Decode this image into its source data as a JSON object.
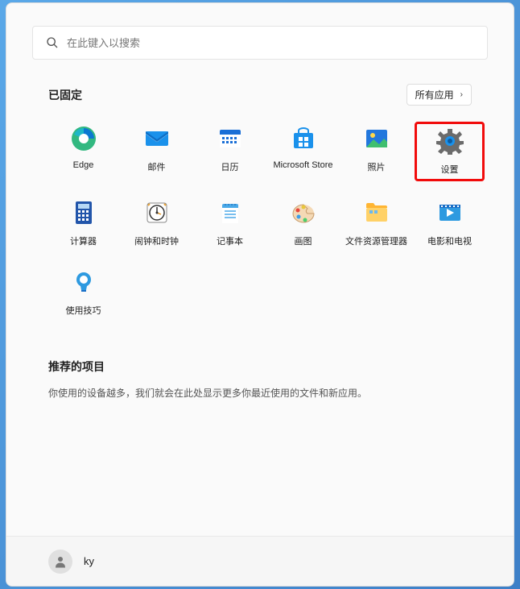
{
  "search": {
    "placeholder": "在此键入以搜索"
  },
  "pinned": {
    "title": "已固定",
    "all_apps_label": "所有应用",
    "tiles": [
      {
        "label": "Edge",
        "icon": "edge"
      },
      {
        "label": "邮件",
        "icon": "mail"
      },
      {
        "label": "日历",
        "icon": "calendar"
      },
      {
        "label": "Microsoft Store",
        "icon": "store"
      },
      {
        "label": "照片",
        "icon": "photos"
      },
      {
        "label": "设置",
        "icon": "settings",
        "highlighted": true
      },
      {
        "label": "计算器",
        "icon": "calculator"
      },
      {
        "label": "闹钟和时钟",
        "icon": "clock"
      },
      {
        "label": "记事本",
        "icon": "notepad"
      },
      {
        "label": "画图",
        "icon": "paint"
      },
      {
        "label": "文件资源管理器",
        "icon": "explorer"
      },
      {
        "label": "电影和电视",
        "icon": "movies"
      },
      {
        "label": "使用技巧",
        "icon": "tips"
      }
    ]
  },
  "recommended": {
    "title": "推荐的项目",
    "description": "你使用的设备越多，我们就会在此处显示更多你最近使用的文件和新应用。"
  },
  "user": {
    "name": "ky"
  }
}
